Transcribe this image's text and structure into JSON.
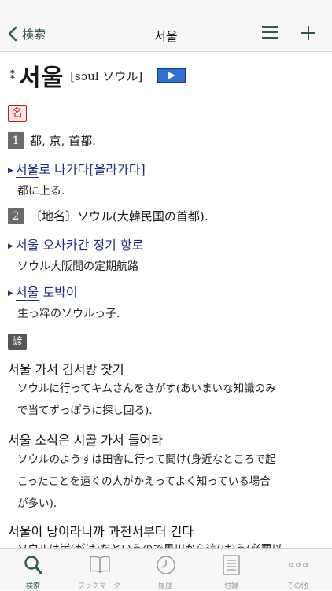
{
  "nav": {
    "back_label": "検索",
    "title": "서울"
  },
  "entry": {
    "headword_mark": "⁑",
    "headword": "서울",
    "pronunciation": "[sɔul ソウル]",
    "pos_badge": "名",
    "sense1": {
      "num": "1",
      "text": "都, 京, 首都."
    },
    "example1": {
      "pre": "",
      "underlined": "서울",
      "rest": "로 나가다[올라가다]",
      "translation": "都に上る."
    },
    "sense2": {
      "num": "2",
      "text": "〔地名〕ソウル(大韓民国の首都)."
    },
    "example2": {
      "underlined": "서울",
      "rest": " 오사카간 정기 항로",
      "translation": "ソウル大阪間の定期航路"
    },
    "example3": {
      "underlined": "서울",
      "rest": " 토박이",
      "translation": "生っ粋のソウルっ子."
    },
    "proverb_badge": "諺",
    "proverbs": [
      {
        "korean": "서울 가서 김서방 찾기",
        "lines": [
          "ソウルに行ってキムさんをさがす(あいまいな知識のみ",
          "で当てずっぽうに探し回る)."
        ]
      },
      {
        "korean": "서울 소식은 시골 가서 들어라",
        "lines": [
          "ソウルのようすは田舎に行って聞け(身近なところで起",
          "こったことを遠くの人がかえってよく知っている場合",
          "が多い)."
        ]
      },
      {
        "korean": "서울이 낭이라니까 과천서부터 긴다",
        "lines": [
          "ソウルは崖(がけ)だというので果川から這(は)う(必要以"
        ]
      }
    ]
  },
  "tabs": [
    {
      "label": "検索",
      "icon": "search-icon",
      "active": true
    },
    {
      "label": "ブックマーク",
      "icon": "bookmark-book-icon",
      "active": false
    },
    {
      "label": "履歴",
      "icon": "history-clock-icon",
      "active": false
    },
    {
      "label": "付録",
      "icon": "appendix-document-icon",
      "active": false
    },
    {
      "label": "その他",
      "icon": "more-dots-icon",
      "active": false
    }
  ],
  "colors": {
    "accent": "#2d5b49",
    "link": "#1c2f8c",
    "pos_badge": "#c8191a",
    "play_button": "#2f6fd1"
  }
}
